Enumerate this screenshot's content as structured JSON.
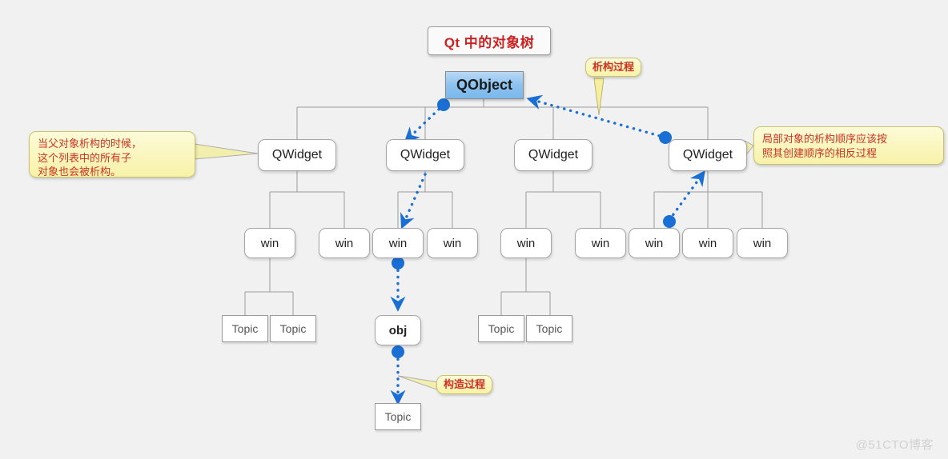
{
  "title": {
    "text": "Qt 中的对象树"
  },
  "watermark": {
    "text": "@51CTO博客"
  },
  "notes": {
    "left": {
      "text": "当父对象析构的时候，\n这个列表中的所有子\n对象也会被析构。"
    },
    "right": {
      "text": "局部对象的析构顺序应该按\n照其创建顺序的相反过程"
    },
    "destruct": {
      "text": "析构过程"
    },
    "construct": {
      "text": "构造过程"
    }
  },
  "nodes": {
    "root": {
      "label": "QObject"
    },
    "widgets": [
      {
        "label": "QWidget"
      },
      {
        "label": "QWidget"
      },
      {
        "label": "QWidget"
      },
      {
        "label": "QWidget"
      }
    ],
    "wins": [
      {
        "label": "win"
      },
      {
        "label": "win"
      },
      {
        "label": "win"
      },
      {
        "label": "win"
      },
      {
        "label": "win"
      },
      {
        "label": "win"
      },
      {
        "label": "win"
      },
      {
        "label": "win"
      },
      {
        "label": "win"
      }
    ],
    "topics": [
      {
        "label": "Topic"
      },
      {
        "label": "Topic"
      },
      {
        "label": "Topic"
      },
      {
        "label": "Topic"
      },
      {
        "label": "Topic"
      }
    ],
    "obj": {
      "label": "obj"
    }
  },
  "colors": {
    "accent_blue": "#1a6fd4",
    "root_fill": "#8cc2ef",
    "note_fill": "#f8f2a8",
    "note_text": "#cc3322",
    "title_text": "#cc2222",
    "line": "#9a9a9a",
    "background": "#f1f1f1"
  },
  "flows": {
    "destruction": "QObject ← QWidget4 ← win7 (析构过程)",
    "construction": "QWidget2 → win3 → obj → Topic5 (构造过程)"
  }
}
